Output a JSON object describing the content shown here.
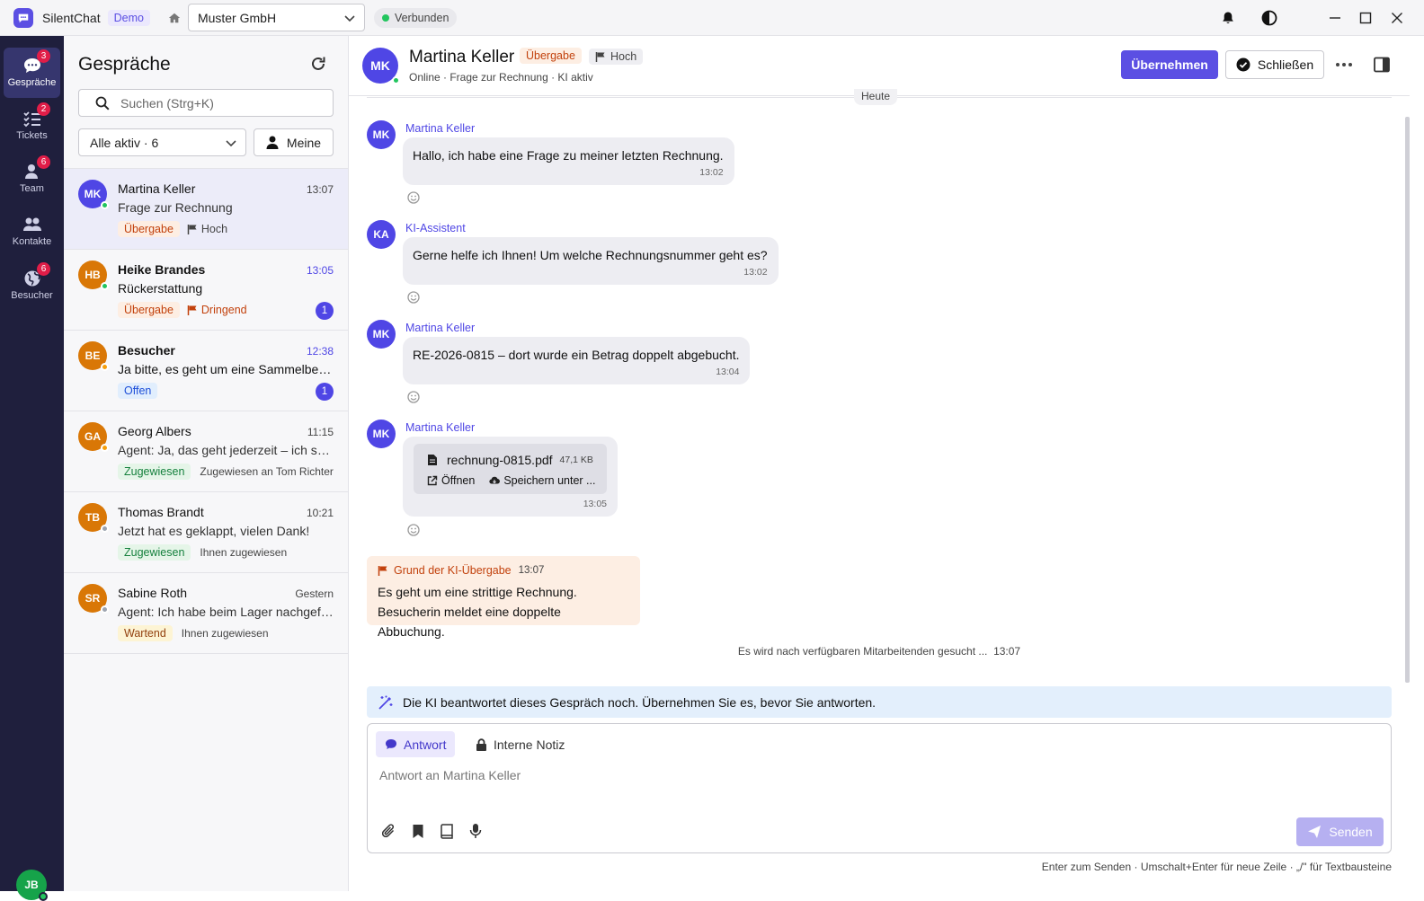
{
  "titlebar": {
    "app_name": "SilentChat",
    "demo_label": "Demo",
    "tenant": "Muster GmbH",
    "connection_status": "Verbunden"
  },
  "nav": {
    "items": [
      {
        "label": "Gespräche",
        "badge": "3",
        "icon": "chat-icon"
      },
      {
        "label": "Tickets",
        "badge": "2",
        "icon": "checklist-icon"
      },
      {
        "label": "Team",
        "badge": "6",
        "icon": "team-icon"
      },
      {
        "label": "Kontakte",
        "badge": "",
        "icon": "contacts-icon"
      },
      {
        "label": "Besucher",
        "badge": "6",
        "icon": "globe-icon"
      }
    ],
    "user_initials": "JB"
  },
  "list": {
    "title": "Gespräche",
    "search_placeholder": "Suchen (Strg+K)",
    "filter": "Alle aktiv · 6",
    "mine_label": "Meine",
    "conversations": [
      {
        "initials": "MK",
        "name": "Martina Keller",
        "time": "13:07",
        "preview": "Frage zur Rechnung",
        "tag": "Übergabe",
        "priority": "Hoch",
        "assigned": "",
        "unread": ""
      },
      {
        "initials": "HB",
        "name": "Heike Brandes",
        "time": "13:05",
        "preview": "Rückerstattung",
        "tag": "Übergabe",
        "priority": "Dringend",
        "assigned": "",
        "unread": "1"
      },
      {
        "initials": "BE",
        "name": "Besucher",
        "time": "12:38",
        "preview": "Ja bitte, es geht um eine Sammelbestellung",
        "tag": "Offen",
        "priority": "",
        "assigned": "",
        "unread": "1"
      },
      {
        "initials": "GA",
        "name": "Georg Albers",
        "time": "11:15",
        "preview": "Agent: Ja, das geht jederzeit – ich schicke Ihnen",
        "tag": "Zugewiesen",
        "priority": "",
        "assigned": "Zugewiesen an Tom Richter",
        "unread": ""
      },
      {
        "initials": "TB",
        "name": "Thomas Brandt",
        "time": "10:21",
        "preview": "Jetzt hat es geklappt, vielen Dank!",
        "tag": "Zugewiesen",
        "priority": "",
        "assigned": "Ihnen zugewiesen",
        "unread": ""
      },
      {
        "initials": "SR",
        "name": "Sabine Roth",
        "time": "Gestern",
        "preview": "Agent: Ich habe beim Lager nachgefragt",
        "tag": "Wartend",
        "priority": "",
        "assigned": "Ihnen zugewiesen",
        "unread": ""
      }
    ]
  },
  "chat": {
    "initials": "MK",
    "name": "Martina Keller",
    "badge": "Übergabe",
    "priority": "Hoch",
    "subtitle": "Online · Frage zur Rechnung · KI aktiv",
    "take_over": "Übernehmen",
    "close": "Schließen",
    "day_label": "Heute",
    "messages": [
      {
        "initials": "MK",
        "author": "Martina Keller",
        "text": "Hallo, ich habe eine Frage zu meiner letzten Rechnung.",
        "time": "13:02"
      },
      {
        "initials": "KA",
        "author": "KI-Assistent",
        "text": "Gerne helfe ich Ihnen! Um welche Rechnungsnummer geht es?",
        "time": "13:02"
      },
      {
        "initials": "MK",
        "author": "Martina Keller",
        "text": "RE-2026-0815 – dort wurde ein Betrag doppelt abgebucht.",
        "time": "13:04"
      },
      {
        "initials": "MK",
        "author": "Martina Keller",
        "file_name": "rechnung-0815.pdf",
        "file_size": "47,1 KB",
        "open_label": "Öffnen",
        "save_label": "Speichern unter ...",
        "time": "13:05"
      }
    ],
    "handoff": {
      "title": "Grund der KI-Übergabe",
      "time": "13:07",
      "line1": "Es geht um eine strittige Rechnung.",
      "line2": "Besucherin meldet eine doppelte Abbuchung."
    },
    "searching": "Es wird nach verfügbaren Mitarbeitenden gesucht ...",
    "searching_time": "13:07",
    "ai_notice": "Die KI beantwortet dieses Gespräch noch. Übernehmen Sie es, bevor Sie antworten.",
    "composer": {
      "tab_reply": "Antwort",
      "tab_note": "Interne Notiz",
      "placeholder": "Antwort an Martina Keller",
      "send": "Senden"
    },
    "hint": "Enter zum Senden · Umschalt+Enter für neue Zeile · „/\" für Textbausteine"
  },
  "colors": {
    "accent": "#5b4fe3",
    "rail": "#1f1f3d",
    "avatar_purple": "#4f46e5",
    "avatar_orange": "#d97706",
    "online": "#22c55e",
    "away": "#f59e0b",
    "offline": "#9ca3af",
    "badge_red": "#e11d48"
  }
}
